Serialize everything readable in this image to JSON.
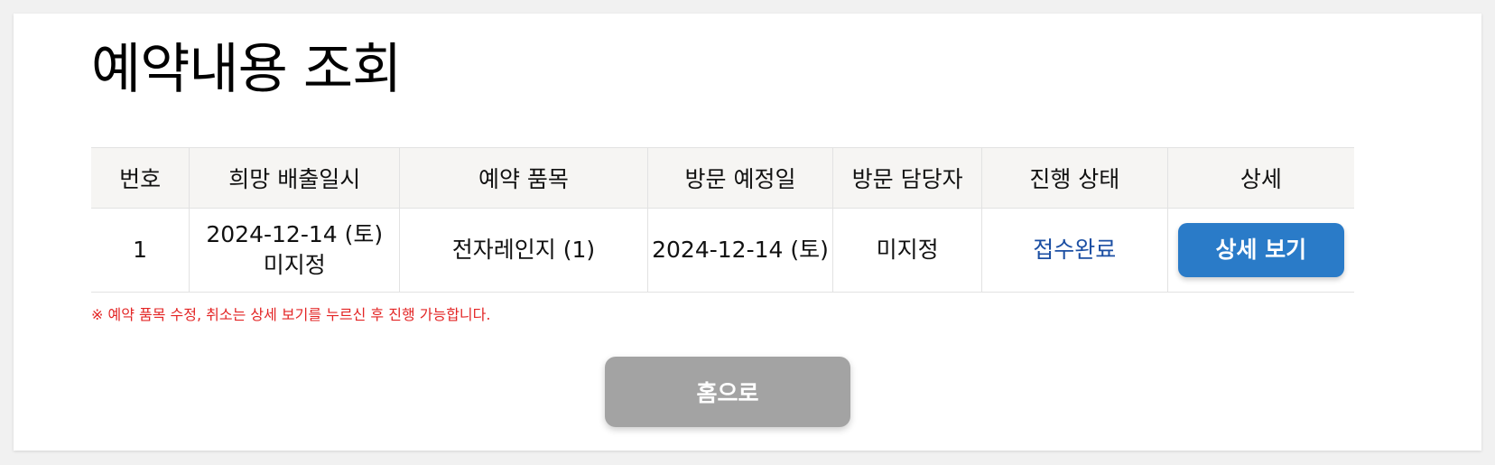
{
  "page": {
    "title": "예약내용 조회"
  },
  "table": {
    "headers": [
      "번호",
      "희망 배출일시",
      "예약 품목",
      "방문 예정일",
      "방문 담당자",
      "진행 상태",
      "상세"
    ],
    "rows": [
      {
        "no": "1",
        "desired_date": "2024-12-14 (토)",
        "desired_time": "미지정",
        "item": "전자레인지 (1)",
        "visit_date": "2024-12-14 (토)",
        "staff": "미지정",
        "status": "접수완료",
        "detail_label": "상세 보기"
      }
    ]
  },
  "notice": "※ 예약 품목 수정, 취소는 상세 보기를 누르신 후 진행 가능합니다.",
  "home_button": "홈으로",
  "colors": {
    "detail_button": "#2a7bc8",
    "home_button": "#a3a3a3",
    "status_text": "#1c4fa3",
    "notice_text": "#e32525",
    "header_bg": "#f6f5f3"
  }
}
